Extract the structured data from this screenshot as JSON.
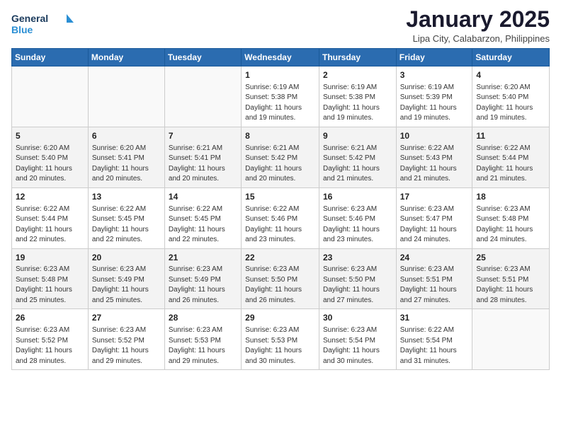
{
  "header": {
    "logo_general": "General",
    "logo_blue": "Blue",
    "month": "January 2025",
    "location": "Lipa City, Calabarzon, Philippines"
  },
  "days_of_week": [
    "Sunday",
    "Monday",
    "Tuesday",
    "Wednesday",
    "Thursday",
    "Friday",
    "Saturday"
  ],
  "weeks": [
    [
      {
        "day": "",
        "info": ""
      },
      {
        "day": "",
        "info": ""
      },
      {
        "day": "",
        "info": ""
      },
      {
        "day": "1",
        "info": "Sunrise: 6:19 AM\nSunset: 5:38 PM\nDaylight: 11 hours and 19 minutes."
      },
      {
        "day": "2",
        "info": "Sunrise: 6:19 AM\nSunset: 5:38 PM\nDaylight: 11 hours and 19 minutes."
      },
      {
        "day": "3",
        "info": "Sunrise: 6:19 AM\nSunset: 5:39 PM\nDaylight: 11 hours and 19 minutes."
      },
      {
        "day": "4",
        "info": "Sunrise: 6:20 AM\nSunset: 5:40 PM\nDaylight: 11 hours and 19 minutes."
      }
    ],
    [
      {
        "day": "5",
        "info": "Sunrise: 6:20 AM\nSunset: 5:40 PM\nDaylight: 11 hours and 20 minutes."
      },
      {
        "day": "6",
        "info": "Sunrise: 6:20 AM\nSunset: 5:41 PM\nDaylight: 11 hours and 20 minutes."
      },
      {
        "day": "7",
        "info": "Sunrise: 6:21 AM\nSunset: 5:41 PM\nDaylight: 11 hours and 20 minutes."
      },
      {
        "day": "8",
        "info": "Sunrise: 6:21 AM\nSunset: 5:42 PM\nDaylight: 11 hours and 20 minutes."
      },
      {
        "day": "9",
        "info": "Sunrise: 6:21 AM\nSunset: 5:42 PM\nDaylight: 11 hours and 21 minutes."
      },
      {
        "day": "10",
        "info": "Sunrise: 6:22 AM\nSunset: 5:43 PM\nDaylight: 11 hours and 21 minutes."
      },
      {
        "day": "11",
        "info": "Sunrise: 6:22 AM\nSunset: 5:44 PM\nDaylight: 11 hours and 21 minutes."
      }
    ],
    [
      {
        "day": "12",
        "info": "Sunrise: 6:22 AM\nSunset: 5:44 PM\nDaylight: 11 hours and 22 minutes."
      },
      {
        "day": "13",
        "info": "Sunrise: 6:22 AM\nSunset: 5:45 PM\nDaylight: 11 hours and 22 minutes."
      },
      {
        "day": "14",
        "info": "Sunrise: 6:22 AM\nSunset: 5:45 PM\nDaylight: 11 hours and 22 minutes."
      },
      {
        "day": "15",
        "info": "Sunrise: 6:22 AM\nSunset: 5:46 PM\nDaylight: 11 hours and 23 minutes."
      },
      {
        "day": "16",
        "info": "Sunrise: 6:23 AM\nSunset: 5:46 PM\nDaylight: 11 hours and 23 minutes."
      },
      {
        "day": "17",
        "info": "Sunrise: 6:23 AM\nSunset: 5:47 PM\nDaylight: 11 hours and 24 minutes."
      },
      {
        "day": "18",
        "info": "Sunrise: 6:23 AM\nSunset: 5:48 PM\nDaylight: 11 hours and 24 minutes."
      }
    ],
    [
      {
        "day": "19",
        "info": "Sunrise: 6:23 AM\nSunset: 5:48 PM\nDaylight: 11 hours and 25 minutes."
      },
      {
        "day": "20",
        "info": "Sunrise: 6:23 AM\nSunset: 5:49 PM\nDaylight: 11 hours and 25 minutes."
      },
      {
        "day": "21",
        "info": "Sunrise: 6:23 AM\nSunset: 5:49 PM\nDaylight: 11 hours and 26 minutes."
      },
      {
        "day": "22",
        "info": "Sunrise: 6:23 AM\nSunset: 5:50 PM\nDaylight: 11 hours and 26 minutes."
      },
      {
        "day": "23",
        "info": "Sunrise: 6:23 AM\nSunset: 5:50 PM\nDaylight: 11 hours and 27 minutes."
      },
      {
        "day": "24",
        "info": "Sunrise: 6:23 AM\nSunset: 5:51 PM\nDaylight: 11 hours and 27 minutes."
      },
      {
        "day": "25",
        "info": "Sunrise: 6:23 AM\nSunset: 5:51 PM\nDaylight: 11 hours and 28 minutes."
      }
    ],
    [
      {
        "day": "26",
        "info": "Sunrise: 6:23 AM\nSunset: 5:52 PM\nDaylight: 11 hours and 28 minutes."
      },
      {
        "day": "27",
        "info": "Sunrise: 6:23 AM\nSunset: 5:52 PM\nDaylight: 11 hours and 29 minutes."
      },
      {
        "day": "28",
        "info": "Sunrise: 6:23 AM\nSunset: 5:53 PM\nDaylight: 11 hours and 29 minutes."
      },
      {
        "day": "29",
        "info": "Sunrise: 6:23 AM\nSunset: 5:53 PM\nDaylight: 11 hours and 30 minutes."
      },
      {
        "day": "30",
        "info": "Sunrise: 6:23 AM\nSunset: 5:54 PM\nDaylight: 11 hours and 30 minutes."
      },
      {
        "day": "31",
        "info": "Sunrise: 6:22 AM\nSunset: 5:54 PM\nDaylight: 11 hours and 31 minutes."
      },
      {
        "day": "",
        "info": ""
      }
    ]
  ]
}
